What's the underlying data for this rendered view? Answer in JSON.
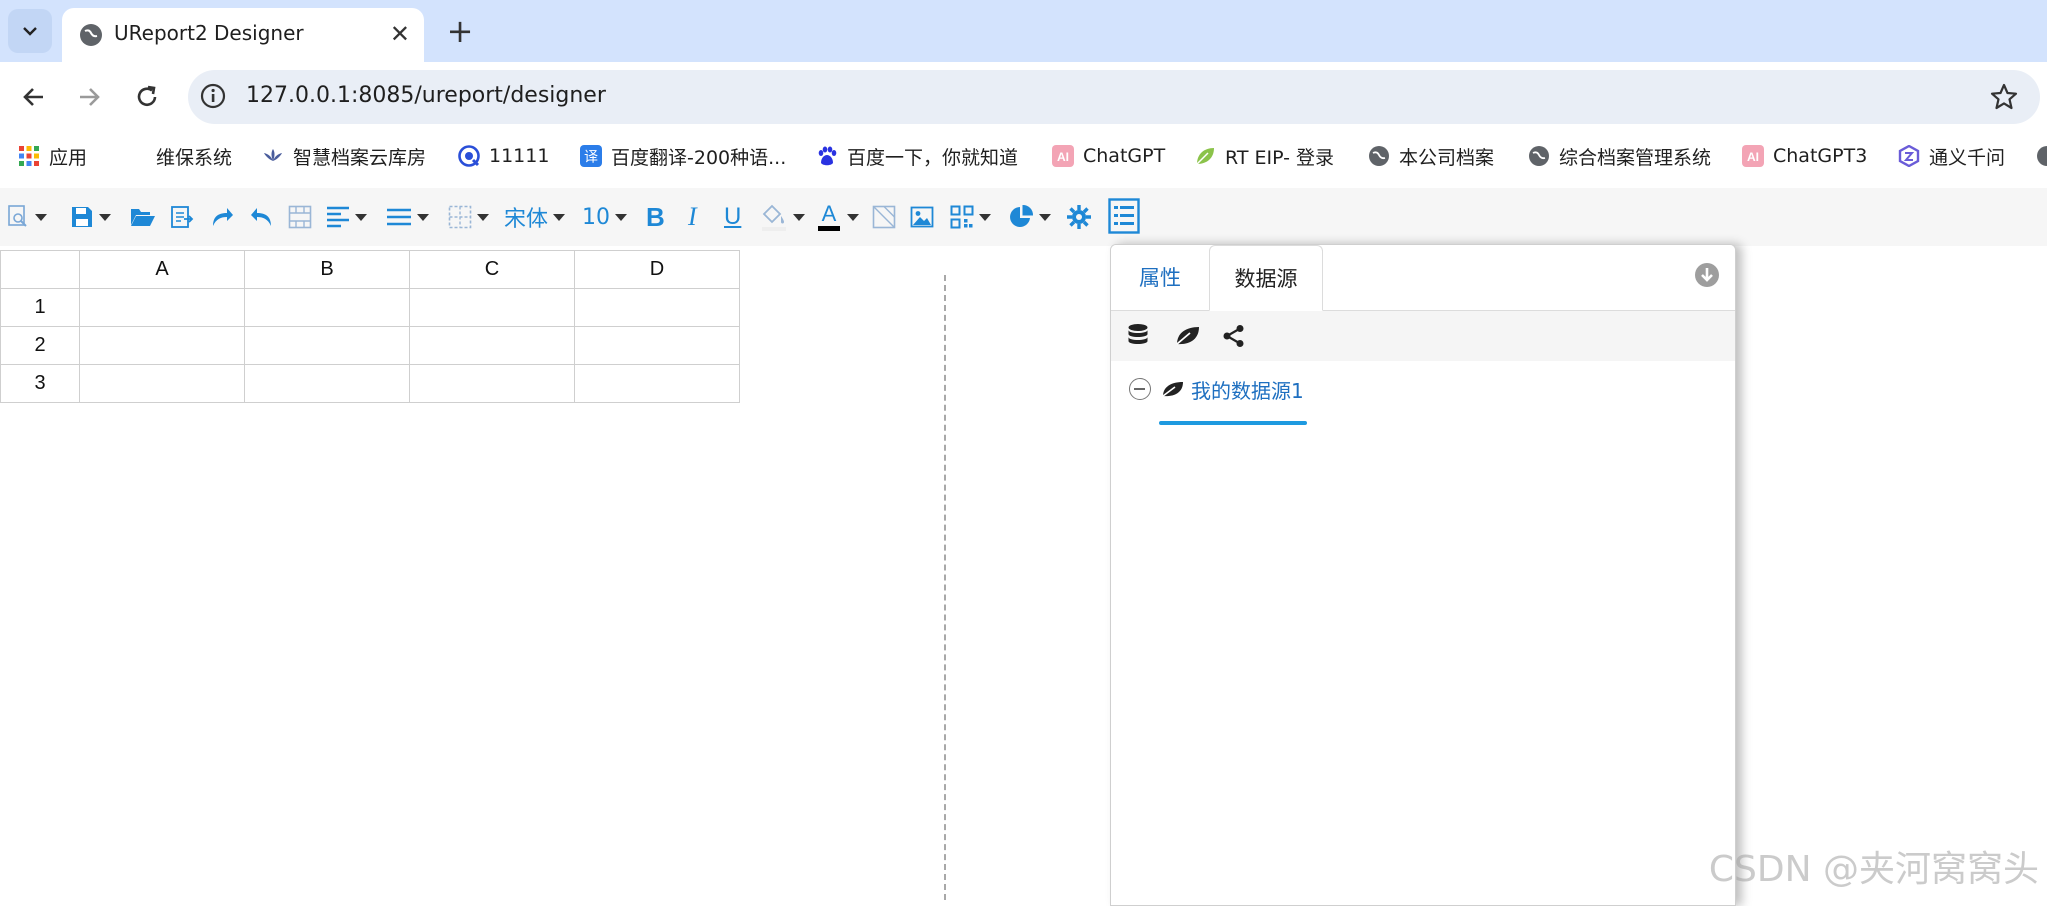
{
  "browser": {
    "tab": {
      "title": "UReport2 Designer",
      "close": "✕"
    },
    "new_tab": "+",
    "url": "127.0.0.1:8085/ureport/designer"
  },
  "bookmarks": [
    {
      "label": "应用",
      "icon": "apps-grid-icon"
    },
    {
      "label": "维保系统",
      "icon": "none"
    },
    {
      "label": "智慧档案云库房",
      "icon": "lotus-icon"
    },
    {
      "label": "11111",
      "icon": "target-icon"
    },
    {
      "label": "百度翻译-200种语...",
      "icon": "translate-icon"
    },
    {
      "label": "百度一下，你就知道",
      "icon": "baidu-paw-icon"
    },
    {
      "label": "ChatGPT",
      "icon": "ai-icon"
    },
    {
      "label": "RT EIP- 登录",
      "icon": "leaf-icon"
    },
    {
      "label": "本公司档案",
      "icon": "globe-icon"
    },
    {
      "label": "综合档案管理系统",
      "icon": "globe-icon"
    },
    {
      "label": "ChatGPT3",
      "icon": "ai-icon"
    },
    {
      "label": "通义千问",
      "icon": "tongyi-icon"
    }
  ],
  "toolbar": {
    "font_name": "宋体",
    "font_size": "10",
    "bold": "B",
    "italic": "I",
    "underline": "U",
    "font_color_letter": "A"
  },
  "grid": {
    "columns": [
      "A",
      "B",
      "C",
      "D"
    ],
    "rows": [
      "1",
      "2",
      "3"
    ]
  },
  "panel": {
    "tabs": [
      "属性",
      "数据源"
    ],
    "active_tab": "数据源",
    "datasource_name": "我的数据源1"
  },
  "colors": {
    "accent": "#1e88d6",
    "tab_strip": "#d3e3fd",
    "tree_underline": "#1e9ae0"
  },
  "watermark": "CSDN @夹河窝窝头"
}
